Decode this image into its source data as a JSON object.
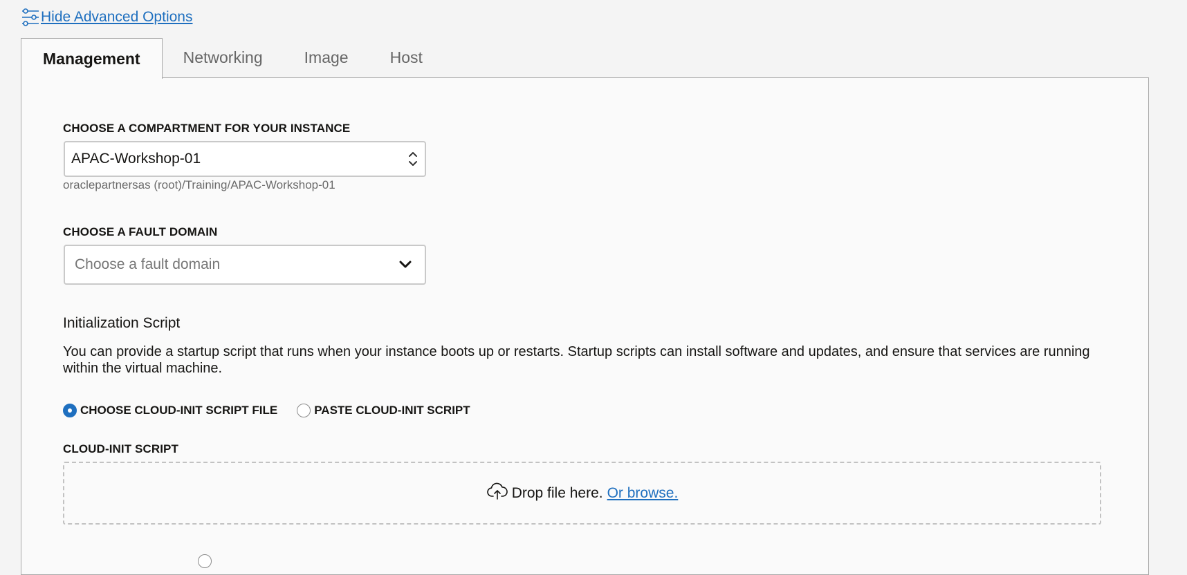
{
  "advanced_toggle": {
    "label": "Hide Advanced Options",
    "icon": "sliders-icon"
  },
  "tabs": [
    {
      "label": "Management",
      "active": true
    },
    {
      "label": "Networking",
      "active": false
    },
    {
      "label": "Image",
      "active": false
    },
    {
      "label": "Host",
      "active": false
    }
  ],
  "compartment": {
    "label": "CHOOSE A COMPARTMENT FOR YOUR INSTANCE",
    "value": "APAC-Workshop-01",
    "path": "oraclepartnersas (root)/Training/APAC-Workshop-01",
    "icon": "up-down-chevron-icon"
  },
  "fault_domain": {
    "label": "CHOOSE A FAULT DOMAIN",
    "placeholder": "Choose a fault domain",
    "icon": "chevron-down-icon"
  },
  "init_script": {
    "title": "Initialization Script",
    "description": "You can provide a startup script that runs when your instance boots up or restarts. Startup scripts can install software and updates, and ensure that services are running within the virtual machine.",
    "options": [
      {
        "label": "CHOOSE CLOUD-INIT SCRIPT FILE",
        "checked": true
      },
      {
        "label": "PASTE CLOUD-INIT SCRIPT",
        "checked": false
      }
    ],
    "field_label": "CLOUD-INIT SCRIPT",
    "dropzone_text": "Drop file here.",
    "browse_text": "Or browse.",
    "dropzone_icon": "cloud-upload-icon"
  },
  "colors": {
    "link": "#1e6fbf",
    "radio_selected": "#1e6fbf",
    "panel_bg": "#fafafa",
    "page_bg": "#f4f4f4",
    "border": "#a8a8a8"
  }
}
